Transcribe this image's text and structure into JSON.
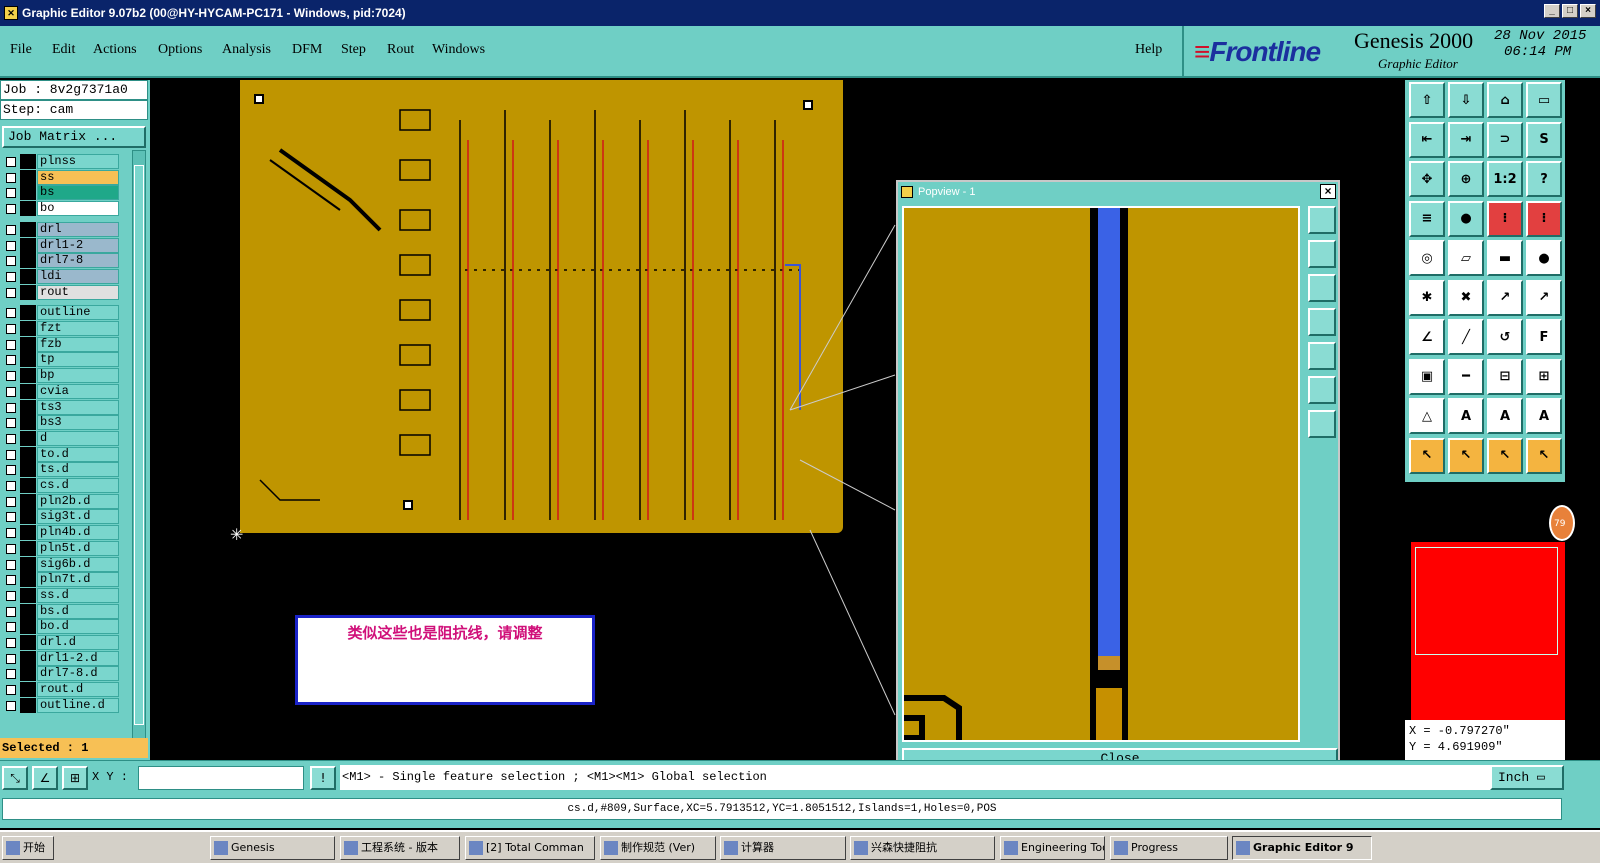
{
  "window": {
    "title": "Graphic Editor 9.07b2 (00@HY-HYCAM-PC171 - Windows, pid:7024)",
    "buttons": [
      "_",
      "□",
      "×"
    ]
  },
  "menu": {
    "items": [
      "File",
      "Edit",
      "Actions",
      "Options",
      "Analysis",
      "DFM",
      "Step",
      "Rout",
      "Windows"
    ],
    "help": "Help"
  },
  "brand": {
    "logo_text": "Frontline",
    "product": "Genesis 2000",
    "subtitle": "Graphic Editor",
    "date": "28 Nov 2015",
    "time": "06:14 PM"
  },
  "left_panel": {
    "job": "Job : 8v2g7371a0",
    "step": "Step: cam",
    "job_matrix_button": "Job Matrix ...",
    "layers": [
      {
        "name": "plnss",
        "color": "#7ad6cd"
      },
      {
        "name": "ss",
        "color": "#f7c055"
      },
      {
        "name": "bs",
        "color": "#1fa889"
      },
      {
        "name": "bo",
        "color": "#ffffff"
      },
      {
        "name": "drl",
        "color": "#9ab8cc"
      },
      {
        "name": "drl1-2",
        "color": "#9ab8cc"
      },
      {
        "name": "drl7-8",
        "color": "#9ab8cc"
      },
      {
        "name": "ldi",
        "color": "#9ab8cc"
      },
      {
        "name": "rout",
        "color": "#e0e0e0"
      },
      {
        "name": "outline",
        "color": "#7ad6cd"
      },
      {
        "name": "fzt",
        "color": "#7ad6cd"
      },
      {
        "name": "fzb",
        "color": "#7ad6cd"
      },
      {
        "name": "tp",
        "color": "#7ad6cd"
      },
      {
        "name": "bp",
        "color": "#7ad6cd"
      },
      {
        "name": "cvia",
        "color": "#7ad6cd"
      },
      {
        "name": "ts3",
        "color": "#7ad6cd"
      },
      {
        "name": "bs3",
        "color": "#7ad6cd"
      },
      {
        "name": "d",
        "color": "#7ad6cd"
      },
      {
        "name": "to.d",
        "color": "#7ad6cd"
      },
      {
        "name": "ts.d",
        "color": "#7ad6cd"
      },
      {
        "name": "cs.d",
        "color": "#7ad6cd"
      },
      {
        "name": "pln2b.d",
        "color": "#7ad6cd"
      },
      {
        "name": "sig3t.d",
        "color": "#7ad6cd"
      },
      {
        "name": "pln4b.d",
        "color": "#7ad6cd"
      },
      {
        "name": "pln5t.d",
        "color": "#7ad6cd"
      },
      {
        "name": "sig6b.d",
        "color": "#7ad6cd"
      },
      {
        "name": "pln7t.d",
        "color": "#7ad6cd"
      },
      {
        "name": "ss.d",
        "color": "#7ad6cd"
      },
      {
        "name": "bs.d",
        "color": "#7ad6cd"
      },
      {
        "name": "bo.d",
        "color": "#7ad6cd"
      },
      {
        "name": "drl.d",
        "color": "#7ad6cd"
      },
      {
        "name": "drl1-2.d",
        "color": "#7ad6cd"
      },
      {
        "name": "drl7-8.d",
        "color": "#7ad6cd"
      },
      {
        "name": "rout.d",
        "color": "#7ad6cd"
      },
      {
        "name": "outline.d",
        "color": "#7ad6cd"
      }
    ],
    "selected": "Selected : 1"
  },
  "annotation": {
    "text": "类似这些也是阻抗线，请调整"
  },
  "popview": {
    "title": "Popview - 1",
    "close_button": "Close"
  },
  "toolbar": {
    "icons": [
      "layer-up-icon",
      "layer-down-icon",
      "home-icon",
      "zoom-window-icon",
      "pan-left-icon",
      "pan-right-icon",
      "fit-icon",
      "zoom-rect-icon",
      "zoom-in-icon",
      "zoom-out-icon",
      "scale-icon",
      "help-icon",
      "measure-icon",
      "snap-icon",
      "layer-compare-icon",
      "layer-stack-icon",
      "pad-icon",
      "surface-icon",
      "ruler-icon",
      "dot-icon",
      "connect-icon",
      "cross-icon",
      "move-icon",
      "split-icon",
      "line-icon",
      "diagonal-icon",
      "arc-icon",
      "fanout-icon",
      "copy-icon",
      "segment-icon",
      "box-icon",
      "clip-icon",
      "triangle-icon",
      "a-outline-icon",
      "a-fill-icon",
      "a-solid-icon",
      "select-arrow-icon",
      "select-box-icon",
      "select-poly-icon",
      "select-multi-icon"
    ],
    "glyphs": [
      "⇧",
      "⇩",
      "⌂",
      "▭",
      "⇤",
      "⇥",
      "⊃",
      "S",
      "✥",
      "⊕",
      "1:2",
      "?",
      "≡",
      "●",
      "⁝",
      "⁝",
      "◎",
      "▱",
      "▬",
      "●",
      "✱",
      "✖",
      "↗",
      "↗",
      "∠",
      "╱",
      "↺",
      "F",
      "▣",
      "━",
      "⊟",
      "⊞",
      "△",
      "A",
      "A",
      "A",
      "↖",
      "↖",
      "↖",
      "↖"
    ],
    "badge": "79"
  },
  "coords": {
    "x": "X = -0.797270\"",
    "y": "Y = 4.691909\""
  },
  "command": {
    "xy_label": "X Y :",
    "xy_value": "",
    "prompt": "<M1> - Single feature selection ; <M1><M1> Global selection",
    "units": "Inch ▭"
  },
  "feature_info": "cs.d,#809,Surface,XC=5.7913512,YC=1.8051512,Islands=1,Holes=0,POS",
  "taskbar": {
    "tasks": [
      "开始",
      "Genesis",
      "工程系统 - 版本",
      "[2] Total Comman",
      "制作规范 (Ver)",
      "计算器",
      "兴森快捷阻抗",
      "Engineering Toolki",
      "Progress",
      "Graphic Editor 9"
    ],
    "active_task": "Graphic Editor 9"
  }
}
